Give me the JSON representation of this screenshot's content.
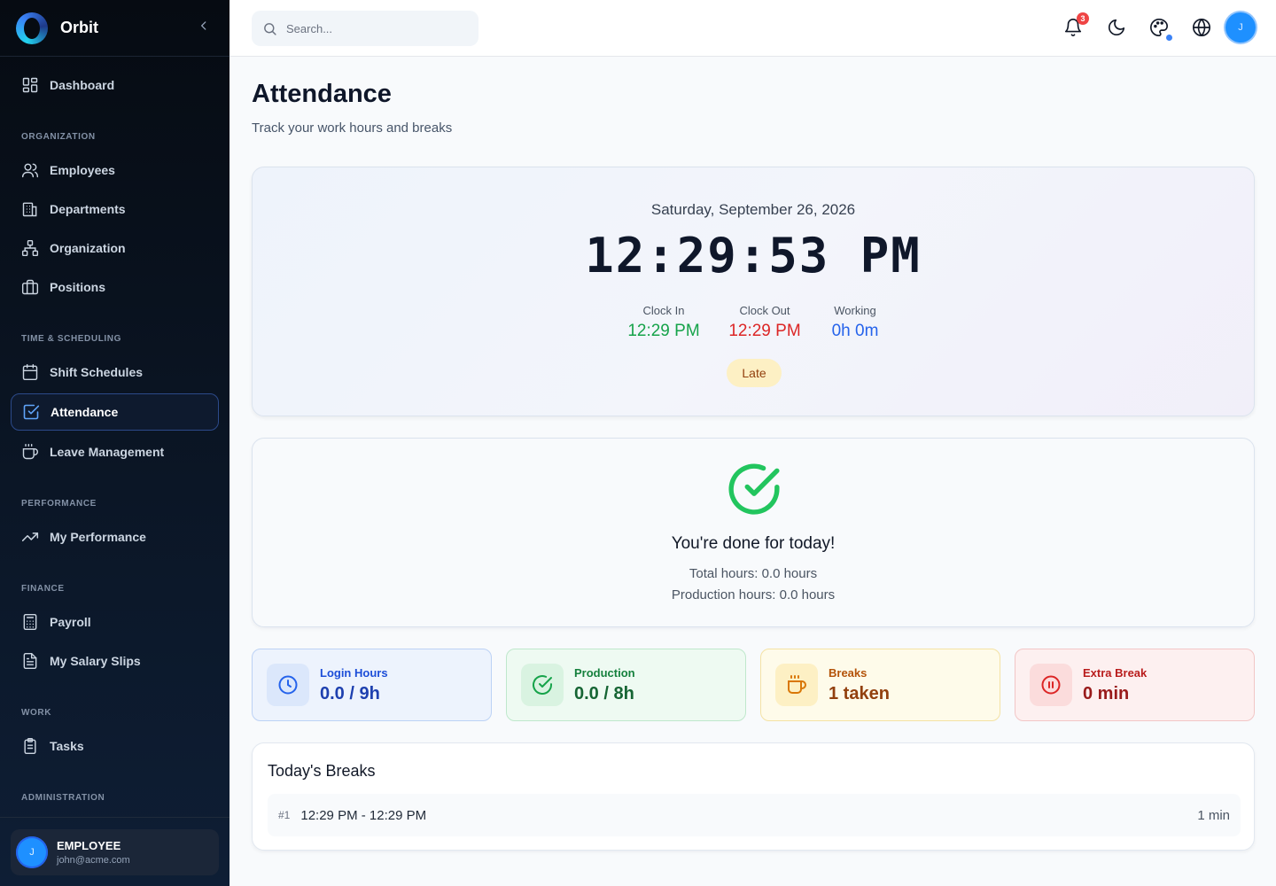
{
  "app": {
    "name": "Orbit"
  },
  "sidebar": {
    "dashboard": "Dashboard",
    "sections": {
      "organization": "ORGANIZATION",
      "time": "TIME & SCHEDULING",
      "performance": "PERFORMANCE",
      "finance": "FINANCE",
      "work": "WORK",
      "administration": "ADMINISTRATION"
    },
    "items": {
      "employees": "Employees",
      "departments": "Departments",
      "organization": "Organization",
      "positions": "Positions",
      "shift_schedules": "Shift Schedules",
      "attendance": "Attendance",
      "leave_management": "Leave Management",
      "my_performance": "My Performance",
      "payroll": "Payroll",
      "my_salary_slips": "My Salary Slips",
      "tasks": "Tasks"
    },
    "active": "attendance",
    "user": {
      "initial": "J",
      "role": "EMPLOYEE",
      "email": "john@acme.com"
    }
  },
  "topbar": {
    "search_placeholder": "Search...",
    "notification_count": "3",
    "avatar_initial": "J"
  },
  "page": {
    "title": "Attendance",
    "subtitle": "Track your work hours and breaks"
  },
  "clock": {
    "date": "Saturday, September 26, 2026",
    "time": "12:29:53 PM",
    "clock_in_label": "Clock In",
    "clock_in_value": "12:29 PM",
    "clock_out_label": "Clock Out",
    "clock_out_value": "12:29 PM",
    "working_label": "Working",
    "working_value": "0h 0m",
    "status": "Late"
  },
  "done": {
    "title": "You're done for today!",
    "total_hours": "Total hours: 0.0 hours",
    "production_hours": "Production hours: 0.0 hours"
  },
  "stats": {
    "login_hours": {
      "label": "Login Hours",
      "value": "0.0 / 9h"
    },
    "production": {
      "label": "Production",
      "value": "0.0 / 8h"
    },
    "breaks": {
      "label": "Breaks",
      "value": "1 taken"
    },
    "extra_break": {
      "label": "Extra Break",
      "value": "0 min"
    }
  },
  "breaks": {
    "title": "Today's Breaks",
    "rows": [
      {
        "num": "#1",
        "range": "12:29 PM - 12:29 PM",
        "duration": "1 min"
      }
    ]
  },
  "colors": {
    "clock_in": "#16a34a",
    "clock_out": "#dc2626",
    "working": "#2563eb",
    "accent_blue": "#1d4ed8",
    "accent_green": "#15803d",
    "accent_amber": "#b45309",
    "accent_red": "#b91c1c"
  },
  "icons": {
    "dashboard": "grid-icon",
    "employees": "users-icon",
    "departments": "building-icon",
    "organization": "org-chart-icon",
    "positions": "briefcase-icon",
    "shift_schedules": "calendar-icon",
    "attendance": "check-square-icon",
    "leave_management": "coffee-icon",
    "my_performance": "trending-up-icon",
    "payroll": "calculator-icon",
    "my_salary_slips": "file-text-icon",
    "tasks": "clipboard-icon"
  }
}
